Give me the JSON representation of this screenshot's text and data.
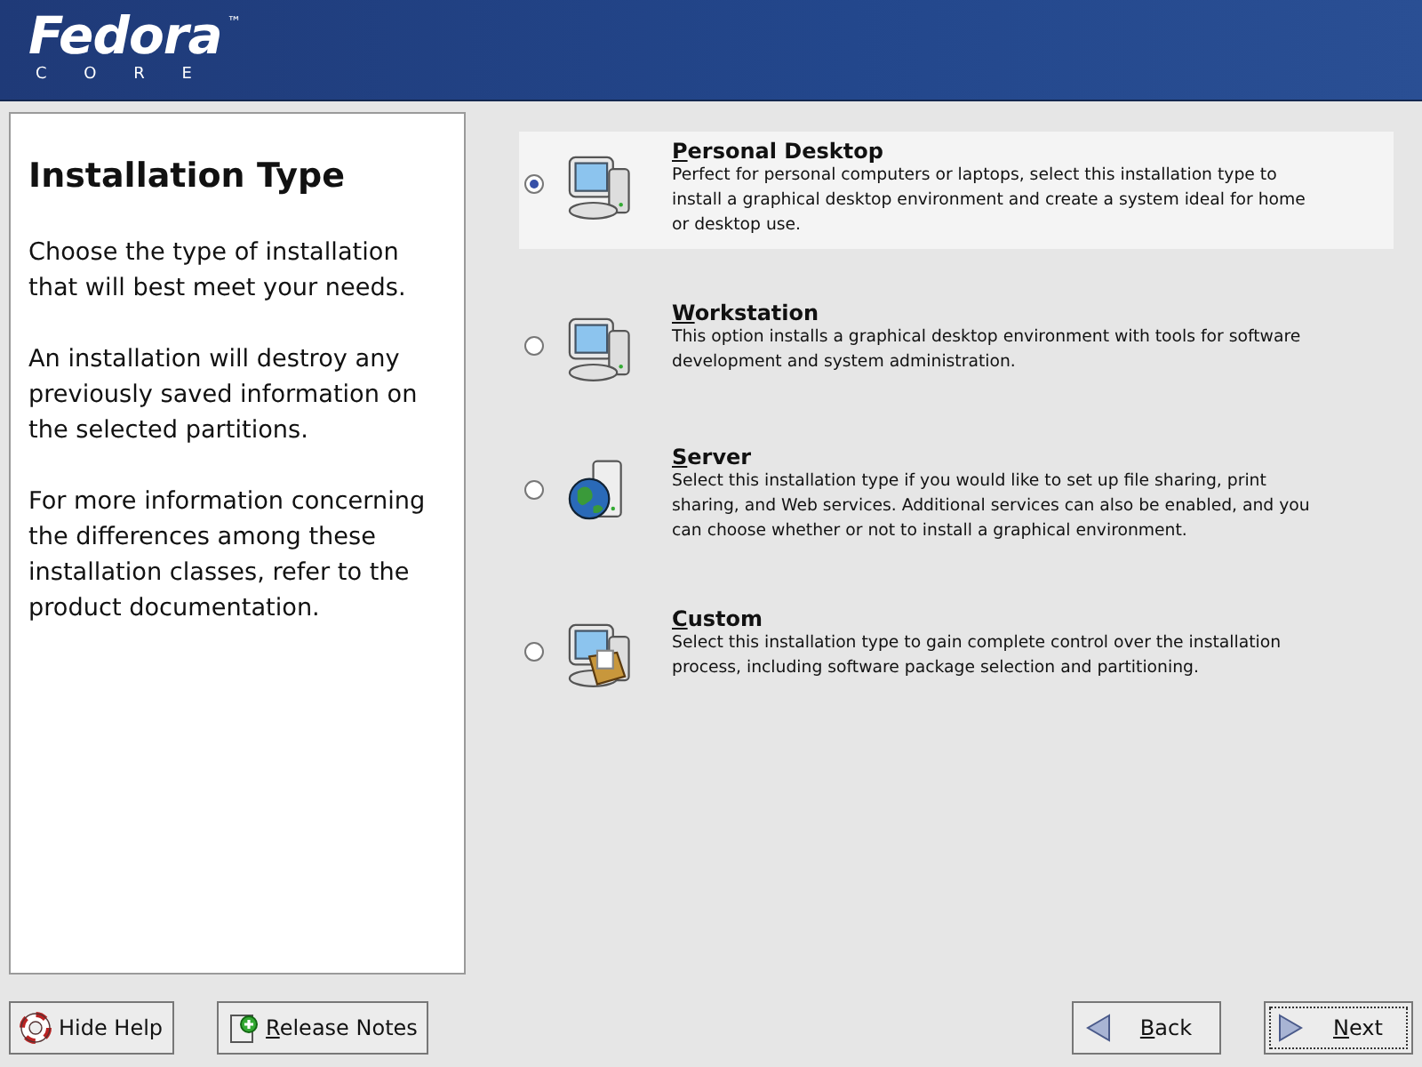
{
  "header": {
    "logo": "Fedora",
    "trademark": "™",
    "sublogo": "C O R E"
  },
  "help": {
    "title": "Installation Type",
    "paragraphs": [
      "Choose the type of installation that will best meet your needs.",
      "An installation will destroy any previously saved information on the selected partitions.",
      "For more information concerning the differences among these installation classes, refer to the product documentation."
    ]
  },
  "options": [
    {
      "kind": "desktop",
      "title": "Personal Desktop",
      "description": "Perfect for personal computers or laptops, select this installation type to install a graphical desktop environment and create a system ideal for home or desktop use.",
      "selected": true
    },
    {
      "kind": "desktop",
      "title": "Workstation",
      "description": "This option installs a graphical desktop environment with tools for software development and system administration.",
      "selected": false
    },
    {
      "kind": "server",
      "title": "Server",
      "description": "Select this installation type if you would like to set up file sharing, print sharing, and Web services. Additional services can also be enabled, and you can choose whether or not to install a graphical environment.",
      "selected": false
    },
    {
      "kind": "custom",
      "title": "Custom",
      "description": "Select this installation type to gain complete control over the installation process, including software package selection and partitioning.",
      "selected": false
    }
  ],
  "buttons": [
    {
      "kind": "help",
      "label": "Hide Help"
    },
    {
      "kind": "notes",
      "label": "Release Notes"
    },
    {
      "kind": "back",
      "label": "Back"
    },
    {
      "kind": "next",
      "label": "Next"
    }
  ]
}
